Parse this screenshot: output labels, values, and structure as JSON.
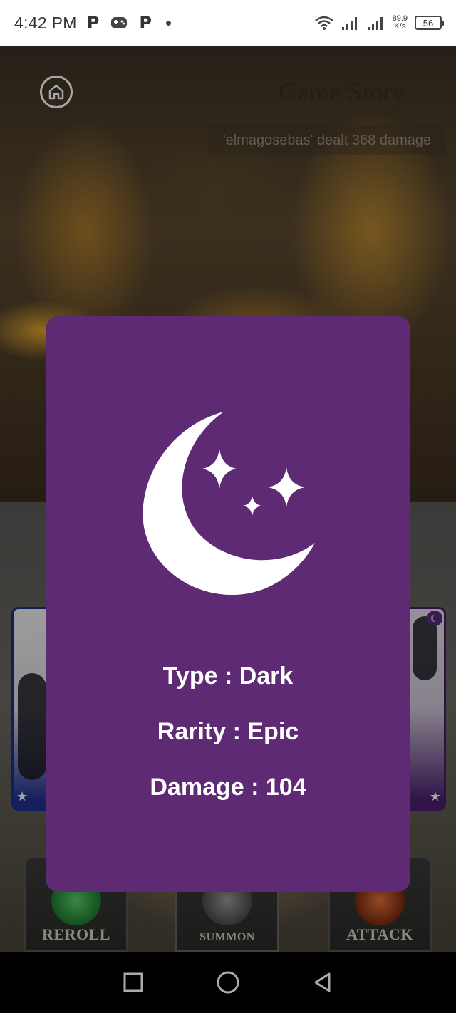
{
  "status_bar": {
    "time": "4:42 PM",
    "net_speed_value": "89.9",
    "net_speed_unit": "K/s",
    "battery": "56",
    "left_icons": [
      "p-icon",
      "gamepad-icon",
      "p-icon",
      "dot-icon"
    ],
    "right_icons": [
      "wifi-icon",
      "signal-icon",
      "signal-icon",
      "battery-icon"
    ]
  },
  "header": {
    "home_icon": "home-icon",
    "title": "Game Story",
    "log_message": "'elmagosebas' dealt 368 damage"
  },
  "card": {
    "background_color": "#5e2a74",
    "icon": "moon-stars-icon",
    "type_text": "Type : Dark",
    "rarity_text": "Rarity : Epic",
    "damage_text": "Damage : 104"
  },
  "actions": {
    "reroll_label": "REROLL",
    "summon_label": "SUMMON",
    "attack_label": "ATTACK"
  },
  "navigation": {
    "icons": [
      "recent-apps-icon",
      "home-nav-icon",
      "back-icon"
    ]
  }
}
